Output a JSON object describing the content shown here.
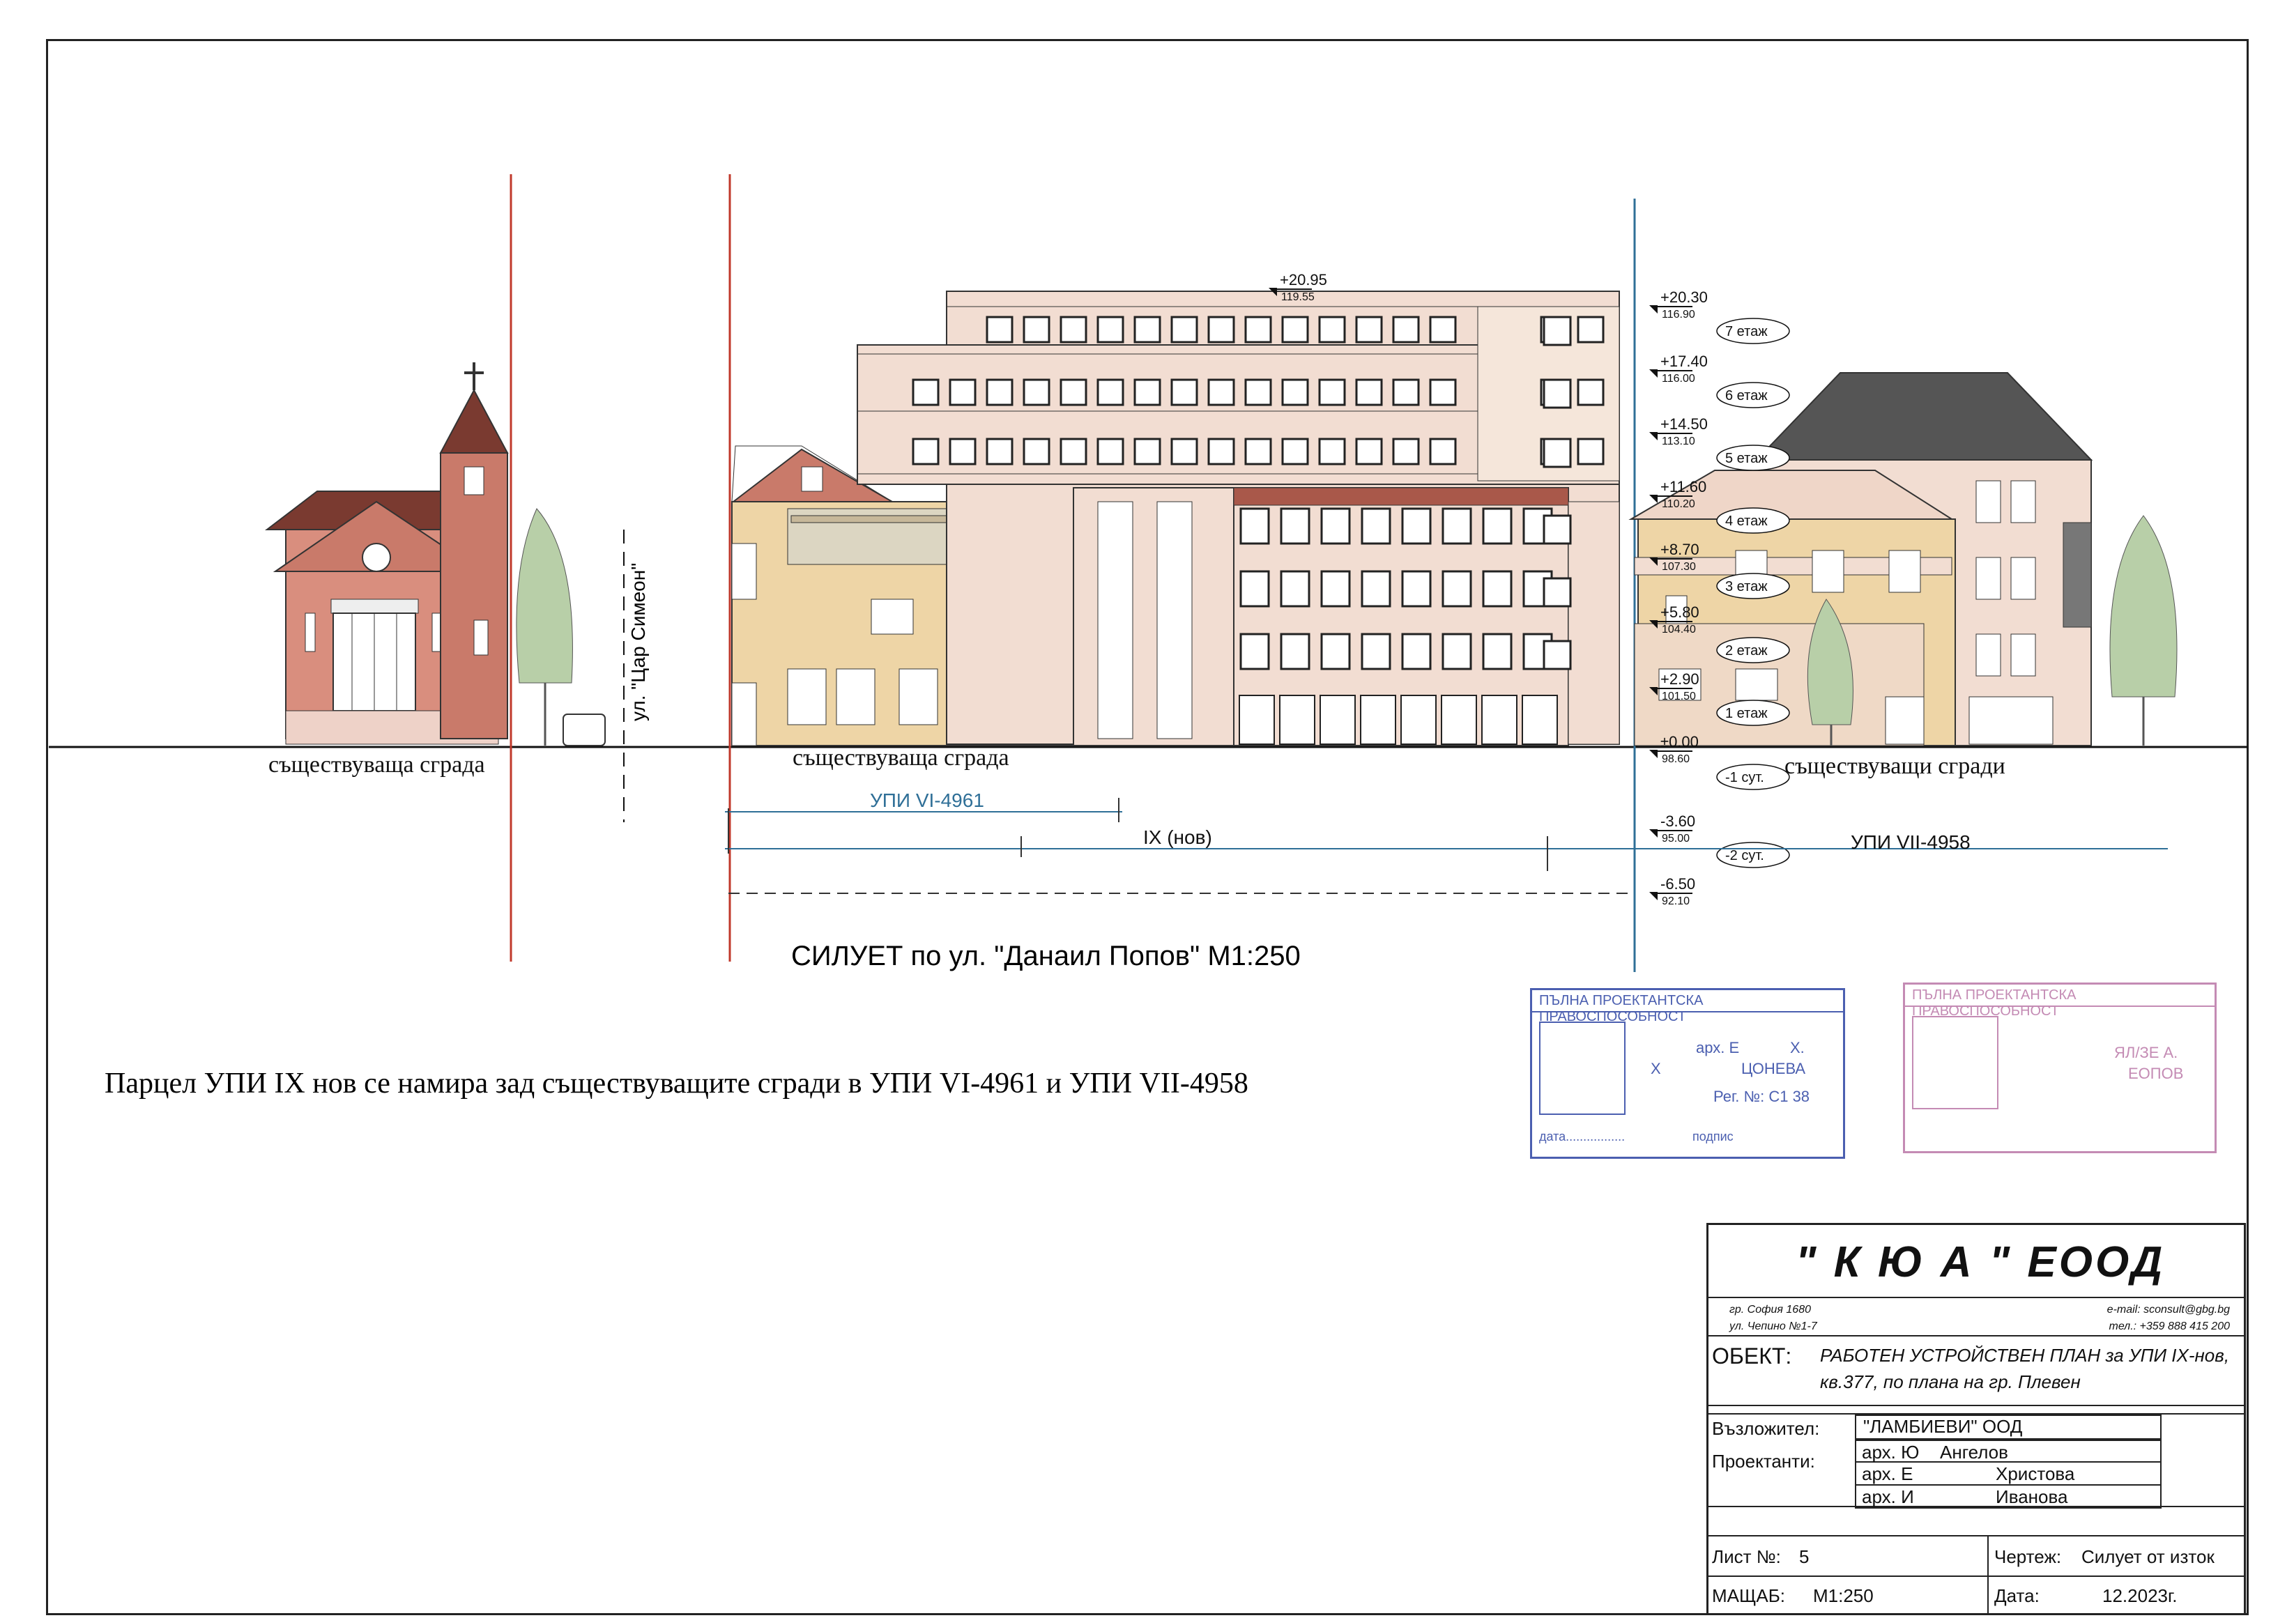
{
  "labels": {
    "existing_building_left": "съществуваща сграда",
    "existing_building_middle": "съществуваща сграда",
    "existing_buildings_right": "съществуващи сгради",
    "street": "ул. \"Цар Симеон\""
  },
  "levels": [
    {
      "value": "+20.95",
      "abs": "119.55"
    },
    {
      "value": "+20.30",
      "abs": "116.90"
    },
    {
      "value": "+17.40",
      "abs": "116.00"
    },
    {
      "value": "+14.50",
      "abs": "113.10"
    },
    {
      "value": "+11.60",
      "abs": "110.20"
    },
    {
      "value": "+8.70",
      "abs": "107.30"
    },
    {
      "value": "+5.80",
      "abs": "104.40"
    },
    {
      "value": "+2.90",
      "abs": "101.50"
    },
    {
      "value": "±0.00",
      "abs": "98.60"
    },
    {
      "value": "-3.60",
      "abs": "95.00"
    },
    {
      "value": "-6.50",
      "abs": "92.10"
    }
  ],
  "floors": [
    "7 етаж",
    "6 етаж",
    "5 етаж",
    "4 етаж",
    "3 етаж",
    "2 етаж",
    "1 етаж",
    "-1 сут.",
    "-2 сут."
  ],
  "plots": {
    "upi_vi": "УПИ VI-4961",
    "upi_ix": "IX (нов)",
    "upi_vii": "УПИ VII-4958"
  },
  "caption": "СИЛУЕТ  по ул. \"Данаил Попов\" М1:250",
  "note": "Парцел УПИ IX нов се намира зад съществуващите сгради в УПИ VI-4961 и УПИ VII-4958",
  "stamp": {
    "header": "ПЪЛНА ПРОЕКТАНТСКА ПРАВОСПОСОБНОСТ",
    "arch": "арх. Е",
    "initial": "Х.",
    "name_left": "Х",
    "name": "ЦОНЕВА",
    "reg": "Рег. №: С1 38",
    "date": "дата.................",
    "sign": "подпис"
  },
  "stamp2": {
    "header": "ПЪЛНА ПРОЕКТАНТСКА ПРАВОСПОСОБНОСТ",
    "arch": "ЯЛ/ЗЕ А.",
    "name": "ЕОПОВ"
  },
  "titleblock": {
    "company": "\" К Ю А \" ЕООД",
    "city": "гр. София 1680",
    "street": "ул. Чепино №1-7",
    "email": "e-mail: sconsult@gbg.bg",
    "phone": "тел.: +359 888 415 200",
    "object_label": "ОБЕКТ:",
    "object_line1": "РАБОТЕН УСТРОЙСТВЕН ПЛАН  за УПИ IX-нов,",
    "object_line2": "кв.377, по плана на  гр. Плевен",
    "client_label": "Възложител:",
    "client": "\"ЛАМБИЕВИ\" ООД",
    "designers_label": "Проектанти:",
    "designers": [
      {
        "title": "арх. Ю",
        "name": "Ангелов"
      },
      {
        "title": "арх. Е",
        "name": "Христова"
      },
      {
        "title": "арх. И",
        "name": "Иванова"
      }
    ],
    "sheet_label": "Лист №:",
    "sheet": "5",
    "drawing_label": "Чертеж:",
    "drawing": "Силует от изток",
    "scale_label": "МАЩАБ:",
    "scale": "М1:250",
    "date_label": "Дата:",
    "date": "12.2023г."
  },
  "colors": {
    "red_line": "#c0392b",
    "blue_line": "#2f6f97",
    "brick": "#c97a6a",
    "roof": "#7a3a30",
    "facade": "#f2ddd2",
    "tree": "#b8cfa8",
    "stamp_blue": "#4b5fb0",
    "stamp_pink": "#c48bb4"
  }
}
